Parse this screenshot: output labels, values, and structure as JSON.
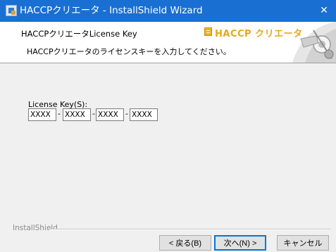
{
  "window": {
    "title": "HACCPクリエータ - InstallShield Wizard",
    "close_glyph": "✕"
  },
  "header": {
    "title": "HACCPクリエータLicense Key",
    "description": "HACCPクリエータのライセンスキーを入力してください。",
    "brand": "HACCP クリエータ"
  },
  "form": {
    "label": "License Key(S):",
    "fields": [
      "XXXX",
      "XXXX",
      "XXXX",
      "XXXX"
    ],
    "separator": "-"
  },
  "footer": {
    "vendor": "InstallShield",
    "back_label": "< 戻る(B)",
    "next_label": "次へ(N) >",
    "cancel_label": "キャンセル"
  },
  "colors": {
    "titlebar": "#1a6fd2",
    "brand": "#e5a91a",
    "default_button_border": "#0078d7"
  }
}
